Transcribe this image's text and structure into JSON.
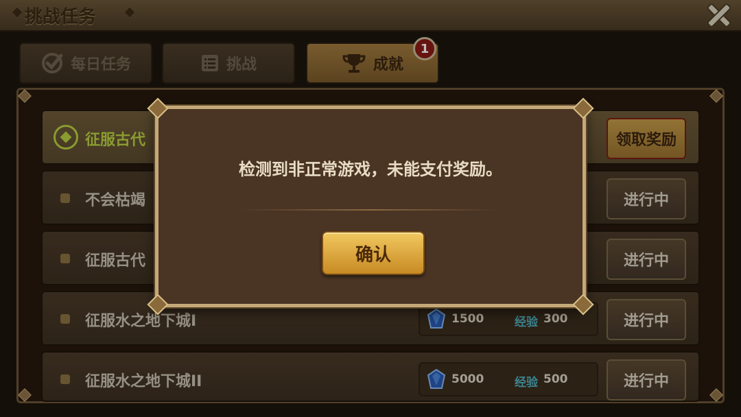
{
  "window": {
    "title": "挑战任务"
  },
  "tabs": [
    {
      "label": "每日任务",
      "icon": "check-circle-icon"
    },
    {
      "label": "挑战",
      "icon": "list-icon"
    },
    {
      "label": "成就",
      "icon": "trophy-icon",
      "badge": "1"
    }
  ],
  "tasks": [
    {
      "label": "征服古代",
      "status": "completed",
      "button": "领取奖励"
    },
    {
      "label": "不会枯竭",
      "status": "in_progress",
      "button": "进行中"
    },
    {
      "label": "征服古代",
      "status": "in_progress",
      "button": "进行中"
    },
    {
      "label": "征服水之地下城I",
      "status": "in_progress",
      "button": "进行中",
      "reward_gems": "1500",
      "reward_exp_label": "经验",
      "reward_exp": "300"
    },
    {
      "label": "征服水之地下城II",
      "status": "in_progress",
      "button": "进行中",
      "reward_gems": "5000",
      "reward_exp_label": "经验",
      "reward_exp": "500"
    }
  ],
  "dialog": {
    "message": "检测到非正常游戏，未能支付奖励。",
    "confirm_label": "确认"
  },
  "colors": {
    "accent_gold": "#c88a24",
    "completed_green": "#b8d040",
    "exp_cyan": "#50b0c0"
  }
}
